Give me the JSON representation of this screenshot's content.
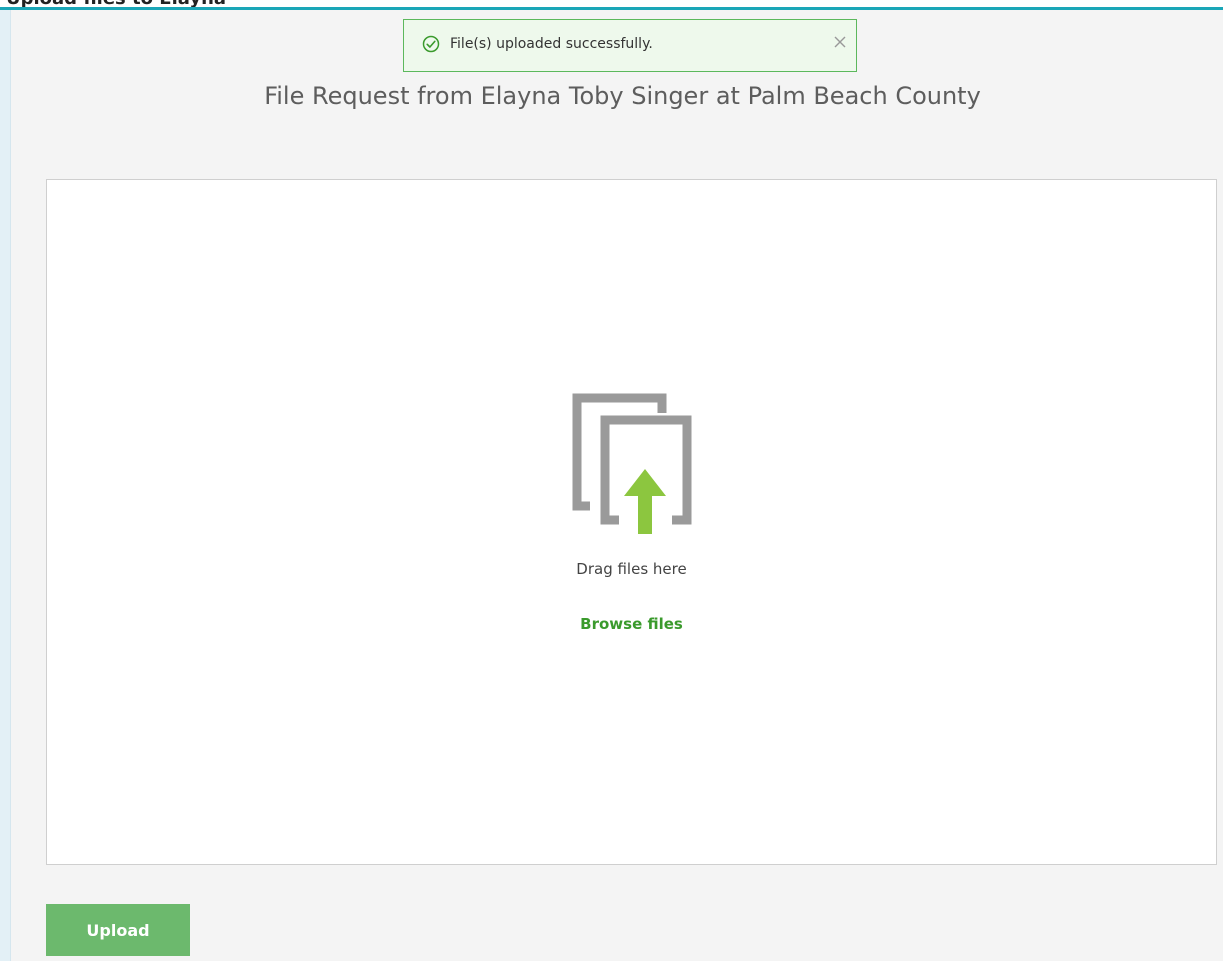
{
  "header": {
    "clipped_heading": "Upload files to Elayna"
  },
  "toast": {
    "message": "File(s) uploaded successfully.",
    "status": "success",
    "icon": "check-circle-icon",
    "close_icon": "close-icon"
  },
  "page": {
    "title": "File Request from Elayna Toby Singer at Palm Beach County"
  },
  "dropzone": {
    "icon": "upload-files-icon",
    "drag_text": "Drag files here",
    "browse_label": "Browse files"
  },
  "actions": {
    "upload_label": "Upload"
  },
  "colors": {
    "accent": "#1aa6b7",
    "success": "#5cb85c",
    "link": "#3a9a2c",
    "button": "#6cb96d",
    "arrow": "#8cc63f",
    "icon_gray": "#9a9a9a"
  }
}
